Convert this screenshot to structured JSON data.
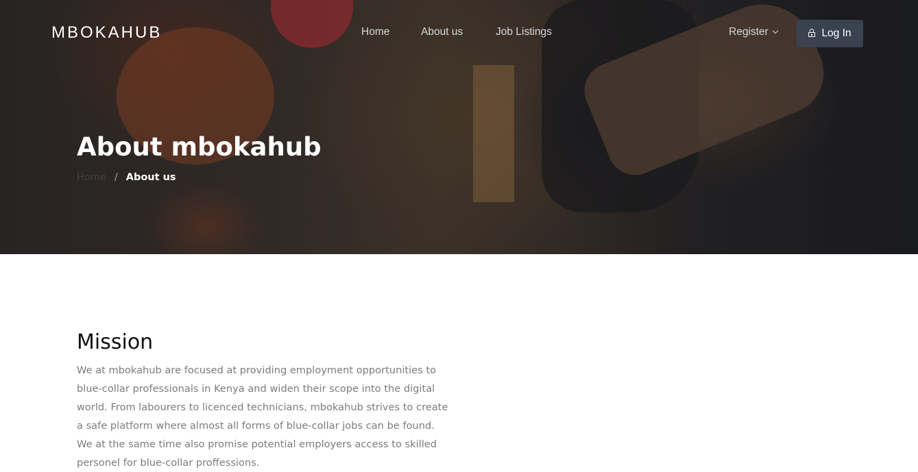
{
  "navbar": {
    "logo": "MBOKAHUB",
    "links": [
      {
        "label": "Home"
      },
      {
        "label": "About us"
      },
      {
        "label": "Job Listings"
      }
    ],
    "register_label": "Register",
    "login_label": "Log In"
  },
  "hero": {
    "title": "About mbokahub",
    "breadcrumb": {
      "home": "Home",
      "separator": "/",
      "current": "About us"
    }
  },
  "mission": {
    "heading": "Mission",
    "body": "We at mbokahub are focused at providing employment opportunities to blue-collar professionals in Kenya and widen their scope into the digital world. From labourers to licenced technicians, mbokahub strives to create a safe platform where almost all forms of blue-collar jobs can be found. We at the same time also promise potential employers access to skilled personel for blue-collar proffessions."
  },
  "colors": {
    "login_button_bg": "#3a4250",
    "body_text": "#7c7c7c",
    "heading_text": "#111111"
  }
}
